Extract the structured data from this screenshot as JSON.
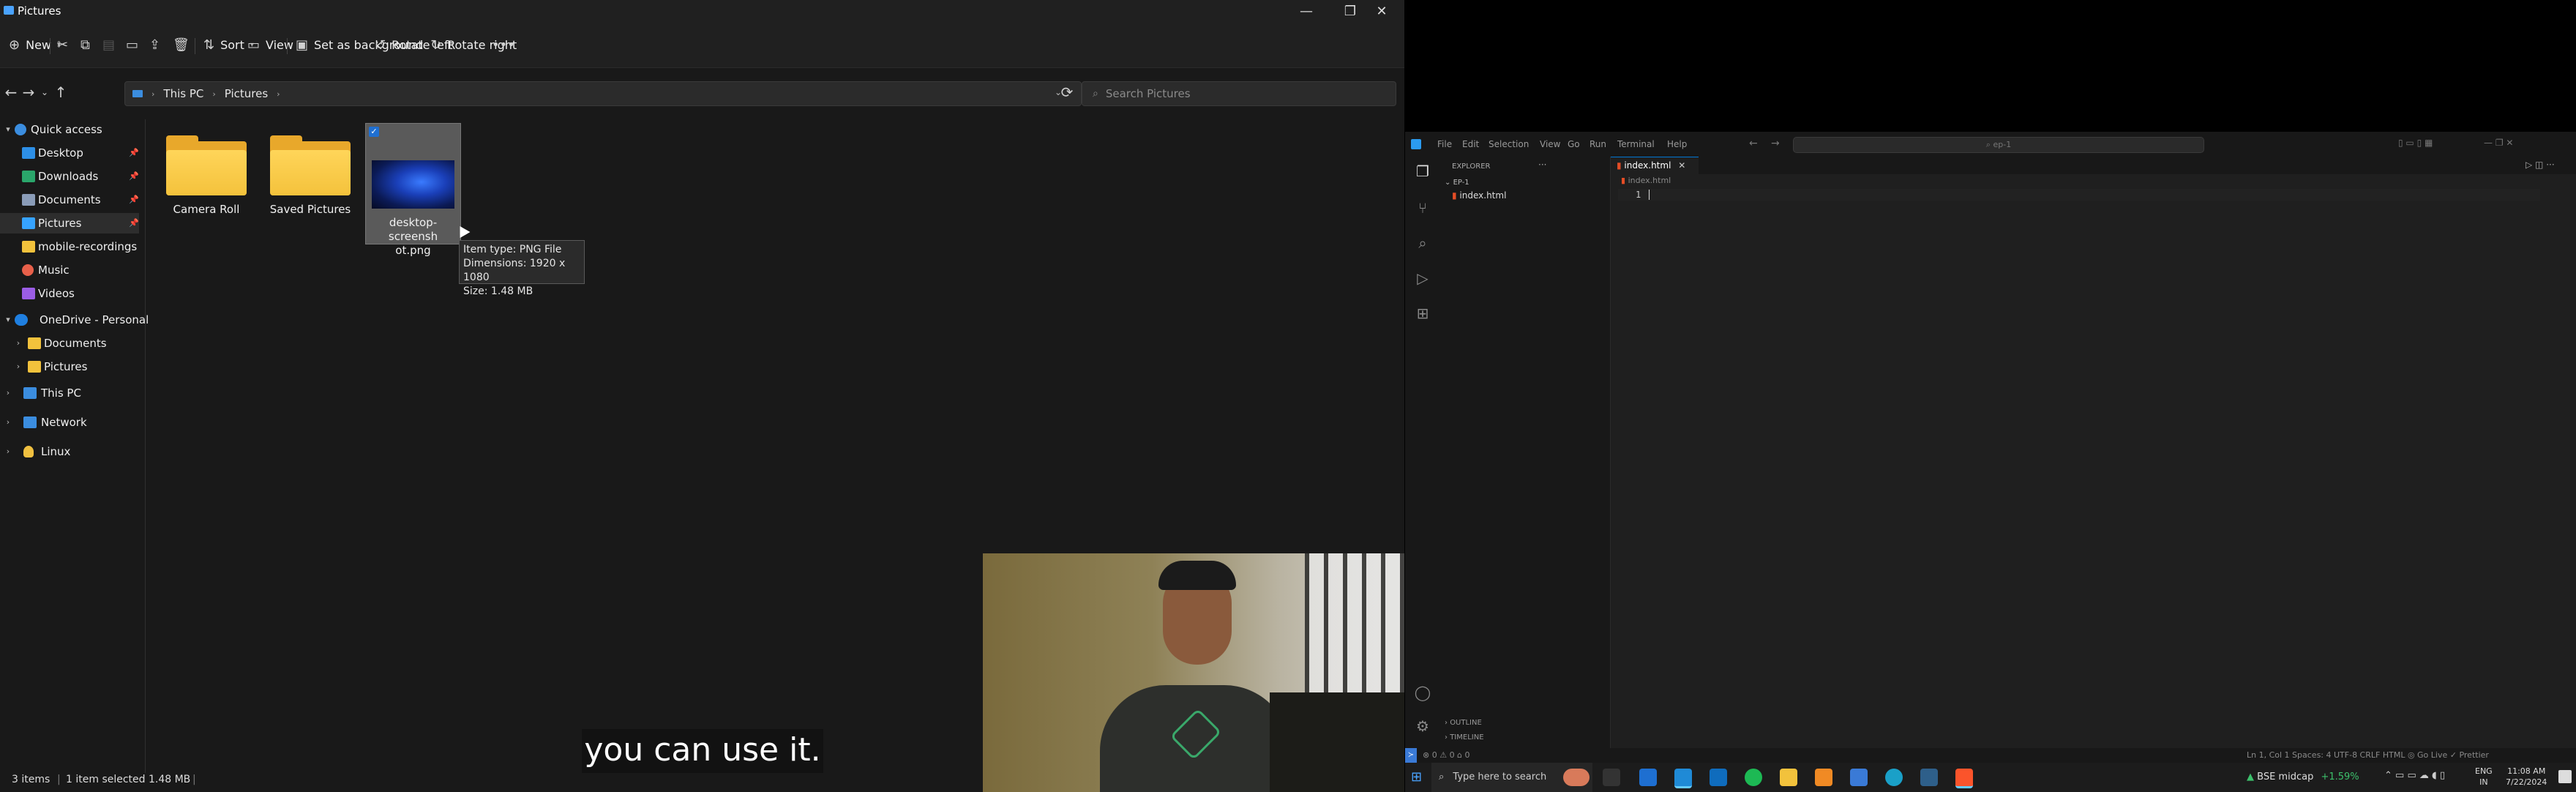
{
  "explorer": {
    "title": "Pictures",
    "toolbar": {
      "new": "New",
      "sort": "Sort",
      "view": "View",
      "set_background": "Set as background",
      "rotate_left": "Rotate left",
      "rotate_right": "Rotate right"
    },
    "address": {
      "segments": [
        "This PC",
        "Pictures"
      ]
    },
    "search_placeholder": "Search Pictures",
    "nav": {
      "quick_access": "Quick access",
      "desktop": "Desktop",
      "downloads": "Downloads",
      "documents": "Documents",
      "pictures": "Pictures",
      "mobile_recordings": "mobile-recordings",
      "music": "Music",
      "videos": "Videos",
      "onedrive": "OneDrive - Personal",
      "od_documents": "Documents",
      "od_pictures": "Pictures",
      "this_pc": "This PC",
      "network": "Network",
      "linux": "Linux"
    },
    "items": {
      "camera_roll": "Camera Roll",
      "saved_pictures": "Saved Pictures",
      "screenshot_line1": "desktop-screensh",
      "screenshot_line2": "ot.png"
    },
    "tooltip": {
      "type": "Item type: PNG File",
      "dimensions": "Dimensions: 1920 x 1080",
      "size": "Size: 1.48 MB"
    },
    "status": {
      "count": "3 items",
      "selected": "1 item selected  1.48 MB"
    },
    "caption": "you can use it."
  },
  "vscode": {
    "menu": [
      "File",
      "Edit",
      "Selection",
      "View",
      "Go",
      "Run",
      "Terminal",
      "Help"
    ],
    "search_text": "ep-1",
    "explorer_label": "EXPLORER",
    "tab": "index.html",
    "folder": "EP-1",
    "file": "index.html",
    "breadcrumb": "index.html",
    "line_number": "1",
    "outline": "OUTLINE",
    "timeline": "TIMELINE",
    "status_left": "⊗ 0  ⚠ 0   ⌂ 0",
    "status_right": "Ln 1, Col 1   Spaces: 4   UTF-8   CRLF   HTML   ◎ Go Live   ✓ Prettier"
  },
  "taskbar": {
    "search": "Type here to search",
    "ticker": "BSE midcap",
    "ticker_change": "+1.59%",
    "lang": "ENG",
    "region": "IN",
    "time": "11:08 AM",
    "date": "7/22/2024"
  },
  "colors": {
    "accent": "#0078d4",
    "folder": "#f4c23c",
    "vscode_bg": "#1f1f1f",
    "positive": "#3cc06b"
  }
}
